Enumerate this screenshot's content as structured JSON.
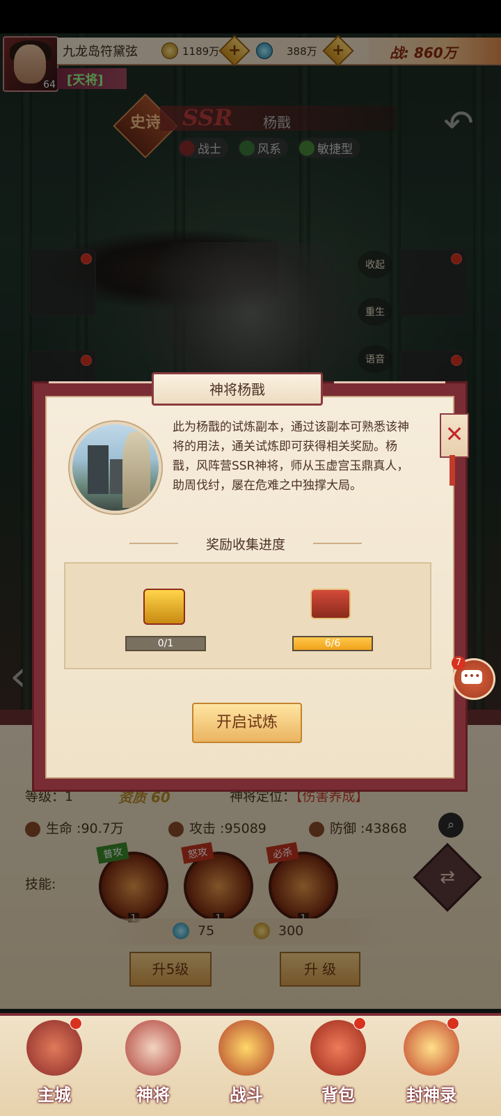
{
  "player": {
    "name": "九龙岛符黛弦",
    "level": "64",
    "rank": "[天将]",
    "gold": "1189万",
    "gems": "388万",
    "power": "战: 860万"
  },
  "hero": {
    "rarity_badge": "史诗",
    "grade": "SSR",
    "name": "杨戬",
    "tags": [
      {
        "label": "战士",
        "icon": "warrior-icon"
      },
      {
        "label": "风系",
        "icon": "wind-element-icon"
      },
      {
        "label": "敏捷型",
        "icon": "agility-icon"
      }
    ],
    "side_actions": [
      "收起",
      "重生",
      "语音"
    ]
  },
  "modal": {
    "title": "神将杨戬",
    "description": "此为杨戬的试炼副本，通过该副本可熟悉该神将的用法，通关试炼即可获得相关奖励。杨戬，风阵营SSR神将，师从玉虚宫玉鼎真人，助周伐纣，屡在危难之中独撑大局。",
    "section_title": "奖励收集进度",
    "rewards": [
      {
        "progress_text": "0/1",
        "fraction": 0
      },
      {
        "progress_text": "6/6",
        "fraction": 1
      }
    ],
    "start_button": "开启试炼"
  },
  "stats": {
    "level": "等级：1",
    "quality": "资质 60",
    "role_label": "神将定位：",
    "role_value": "【伤害养成】",
    "hp": "生命 :90.7万",
    "attack": "攻击 :95089",
    "defense": "防御 :43868",
    "skills_label": "技能:",
    "skills": [
      {
        "badge": "普攻",
        "count": "1"
      },
      {
        "badge": "怒攻",
        "count": "1"
      },
      {
        "badge": "必杀",
        "count": "1"
      }
    ],
    "cost_gem": "75",
    "cost_gold": "300",
    "upgrade5": "升5级",
    "upgrade": "升 级"
  },
  "chat": {
    "unread": "7"
  },
  "nav": [
    {
      "label": "主城",
      "icon": "city-icon",
      "dot": true
    },
    {
      "label": "神将",
      "icon": "hero-icon",
      "dot": false
    },
    {
      "label": "战斗",
      "icon": "battle-icon",
      "dot": false
    },
    {
      "label": "背包",
      "icon": "bag-icon",
      "dot": true
    },
    {
      "label": "封神录",
      "icon": "fengshen-record-icon",
      "dot": true
    }
  ],
  "colors": {
    "modal_frame": "#7a2c34",
    "parchment": "#f6ecdb",
    "accent_red": "#c1272d",
    "progress_gold": "#f0a21a"
  }
}
